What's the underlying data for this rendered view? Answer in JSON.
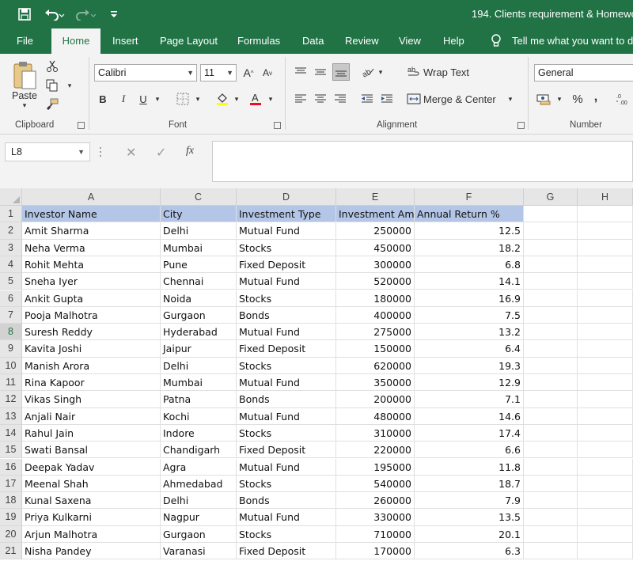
{
  "title_bar": {
    "document_title": "194. Clients requirement & Homewo",
    "quick_access": [
      "save-icon",
      "undo-icon",
      "redo-icon",
      "customize-icon"
    ]
  },
  "tabs": [
    "File",
    "Home",
    "Insert",
    "Page Layout",
    "Formulas",
    "Data",
    "Review",
    "View",
    "Help"
  ],
  "active_tab": "Home",
  "tell_me": "Tell me what you want to d",
  "ribbon": {
    "clipboard": {
      "label": "Clipboard",
      "paste": "Paste"
    },
    "font": {
      "label": "Font",
      "family": "Calibri",
      "size": "11",
      "bold": "B",
      "italic": "I",
      "underline": "U"
    },
    "alignment": {
      "label": "Alignment",
      "wrap_text": "Wrap Text",
      "merge_center": "Merge & Center"
    },
    "number": {
      "label": "Number",
      "format": "General",
      "percent": "%",
      "comma": ","
    }
  },
  "formula_bar": {
    "name_box": "L8",
    "fx": "fx",
    "formula": ""
  },
  "grid": {
    "columns": [
      "A",
      "C",
      "D",
      "E",
      "F",
      "G",
      "H"
    ],
    "active_row": 8,
    "header": [
      "Investor Name",
      "City",
      "Investment Type",
      "Investment Amount",
      "Annual Return %"
    ],
    "rows": [
      {
        "n": 2,
        "name": "Amit Sharma",
        "city": "Delhi",
        "type": "Mutual Fund",
        "amount": "250000",
        "ret": "12.5"
      },
      {
        "n": 3,
        "name": "Neha Verma",
        "city": "Mumbai",
        "type": "Stocks",
        "amount": "450000",
        "ret": "18.2"
      },
      {
        "n": 4,
        "name": "Rohit Mehta",
        "city": "Pune",
        "type": "Fixed Deposit",
        "amount": "300000",
        "ret": "6.8"
      },
      {
        "n": 5,
        "name": "Sneha Iyer",
        "city": "Chennai",
        "type": "Mutual Fund",
        "amount": "520000",
        "ret": "14.1"
      },
      {
        "n": 6,
        "name": "Ankit Gupta",
        "city": "Noida",
        "type": "Stocks",
        "amount": "180000",
        "ret": "16.9"
      },
      {
        "n": 7,
        "name": "Pooja Malhotra",
        "city": "Gurgaon",
        "type": "Bonds",
        "amount": "400000",
        "ret": "7.5"
      },
      {
        "n": 8,
        "name": "Suresh Reddy",
        "city": "Hyderabad",
        "type": "Mutual Fund",
        "amount": "275000",
        "ret": "13.2"
      },
      {
        "n": 9,
        "name": "Kavita Joshi",
        "city": "Jaipur",
        "type": "Fixed Deposit",
        "amount": "150000",
        "ret": "6.4"
      },
      {
        "n": 10,
        "name": "Manish Arora",
        "city": "Delhi",
        "type": "Stocks",
        "amount": "620000",
        "ret": "19.3"
      },
      {
        "n": 11,
        "name": "Rina Kapoor",
        "city": "Mumbai",
        "type": "Mutual Fund",
        "amount": "350000",
        "ret": "12.9"
      },
      {
        "n": 12,
        "name": "Vikas Singh",
        "city": "Patna",
        "type": "Bonds",
        "amount": "200000",
        "ret": "7.1"
      },
      {
        "n": 13,
        "name": "Anjali Nair",
        "city": "Kochi",
        "type": "Mutual Fund",
        "amount": "480000",
        "ret": "14.6"
      },
      {
        "n": 14,
        "name": "Rahul Jain",
        "city": "Indore",
        "type": "Stocks",
        "amount": "310000",
        "ret": "17.4"
      },
      {
        "n": 15,
        "name": "Swati Bansal",
        "city": "Chandigarh",
        "type": "Fixed Deposit",
        "amount": "220000",
        "ret": "6.6"
      },
      {
        "n": 16,
        "name": "Deepak Yadav",
        "city": "Agra",
        "type": "Mutual Fund",
        "amount": "195000",
        "ret": "11.8"
      },
      {
        "n": 17,
        "name": "Meenal Shah",
        "city": "Ahmedabad",
        "type": "Stocks",
        "amount": "540000",
        "ret": "18.7"
      },
      {
        "n": 18,
        "name": "Kunal Saxena",
        "city": "Delhi",
        "type": "Bonds",
        "amount": "260000",
        "ret": "7.9"
      },
      {
        "n": 19,
        "name": "Priya Kulkarni",
        "city": "Nagpur",
        "type": "Mutual Fund",
        "amount": "330000",
        "ret": "13.5"
      },
      {
        "n": 20,
        "name": "Arjun Malhotra",
        "city": "Gurgaon",
        "type": "Stocks",
        "amount": "710000",
        "ret": "20.1"
      },
      {
        "n": 21,
        "name": "Nisha Pandey",
        "city": "Varanasi",
        "type": "Fixed Deposit",
        "amount": "170000",
        "ret": "6.3"
      }
    ]
  },
  "colors": {
    "excel_green": "#217346",
    "header_fill": "#b4c6e7",
    "ribbon_bg": "#f3f3f3"
  }
}
